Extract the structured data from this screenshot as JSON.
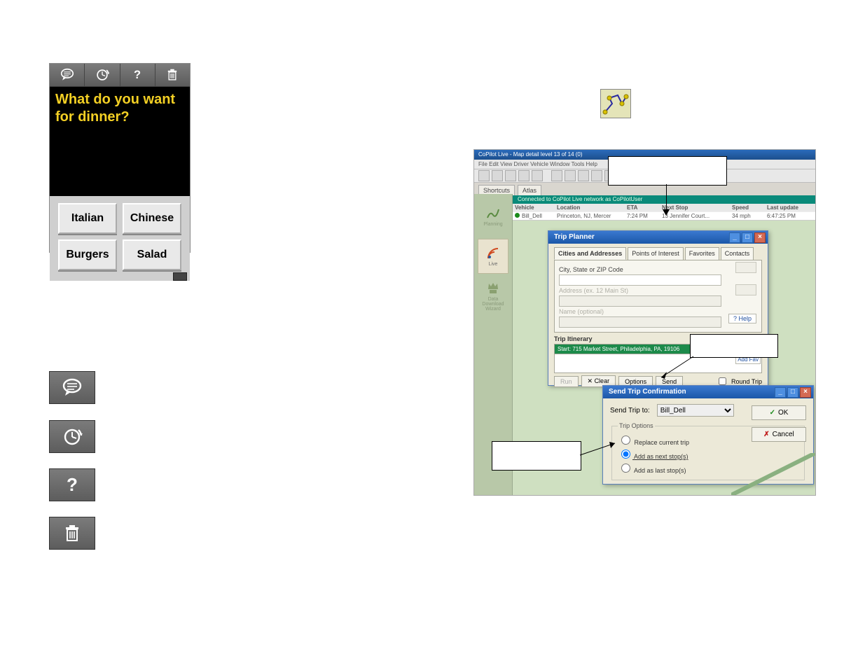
{
  "mobile": {
    "topbar_icons": [
      "speech-icon",
      "defer-icon",
      "help-icon",
      "trash-icon"
    ],
    "message": "What do you want for dinner?",
    "choices": [
      "Italian",
      "Chinese",
      "Burgers",
      "Salad"
    ]
  },
  "option_icons": {
    "speech": "speech-icon",
    "defer": "defer-icon",
    "help": "help-icon",
    "trash": "trash-icon"
  },
  "desktop": {
    "app_title": "CoPilot Live - Map detail level 13 of 14 (0)",
    "menubar": "File  Edit  View  Driver  Vehicle  Window  Tools  Help",
    "atlas_tabs": [
      "Shortcuts",
      "Atlas"
    ],
    "status": "Connected to CoPilot Live network as CoPilotUser",
    "vehicle_table": {
      "headers": [
        "Vehicle",
        "Location",
        "ETA",
        "Next Stop",
        "Speed",
        "Last update"
      ],
      "row": [
        "Bill_Dell",
        "Princeton, NJ, Mercer",
        "7:24 PM",
        "13 Jennifer Court...",
        "34 mph",
        "6:47:25 PM"
      ]
    },
    "sidebar_items": [
      "Planning",
      "Live",
      "Data Download Wizard"
    ],
    "trip_icon": "send-trip-icon"
  },
  "trip_planner": {
    "title": "Trip Planner",
    "tabs": [
      "Cities and Addresses",
      "Points of Interest",
      "Favorites",
      "Contacts"
    ],
    "field_labels": {
      "city": "City, State or ZIP Code",
      "address": "Address (ex. 12 Main St)",
      "name": "Name (optional)"
    },
    "help_btn": "Help",
    "itinerary_label": "Trip Itinerary",
    "itinerary_item": "Start: 715 Market Street, Philadelphia, PA, 19106",
    "add_fav": "Add Fav",
    "buttons": {
      "run": "Run",
      "clear": "Clear",
      "options": "Options",
      "send": "Send",
      "round_trip": "Round Trip"
    }
  },
  "send_trip": {
    "title": "Send Trip Confirmation",
    "label": "Send Trip to:",
    "recipient": "Bill_Dell",
    "options_legend": "Trip Options",
    "options": {
      "replace": "Replace current trip",
      "add_next": "Add as next stop(s)",
      "add_last": "Add as last stop(s)"
    },
    "ok": "OK",
    "cancel": "Cancel"
  }
}
